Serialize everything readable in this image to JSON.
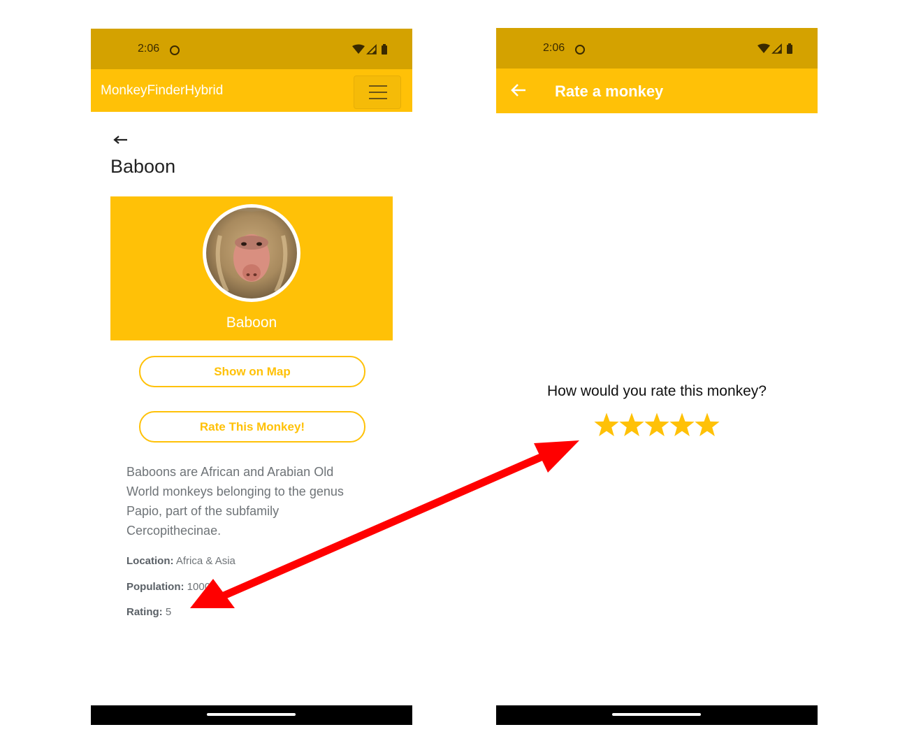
{
  "left_screen": {
    "status": {
      "time": "2:06"
    },
    "appbar": {
      "title": "MonkeyFinderHybrid"
    },
    "page": {
      "title": "Baboon",
      "hero_name": "Baboon",
      "show_on_map_label": "Show on Map",
      "rate_label": "Rate This Monkey!",
      "description": "Baboons are African and Arabian Old World monkeys belonging to the genus Papio, part of the subfamily Cercopithecinae.",
      "location_label": "Location:",
      "location_value": "Africa & Asia",
      "population_label": "Population:",
      "population_value": "10000",
      "rating_label": "Rating:",
      "rating_value": "5"
    }
  },
  "right_screen": {
    "status": {
      "time": "2:06"
    },
    "appbar": {
      "title": "Rate a monkey"
    },
    "question": "How would you rate this monkey?",
    "rating": {
      "filled_stars": 5,
      "max_stars": 5
    }
  },
  "colors": {
    "accent": "#ffc107",
    "status_bar": "#d4a200",
    "annotation_arrow": "#ff0000"
  }
}
